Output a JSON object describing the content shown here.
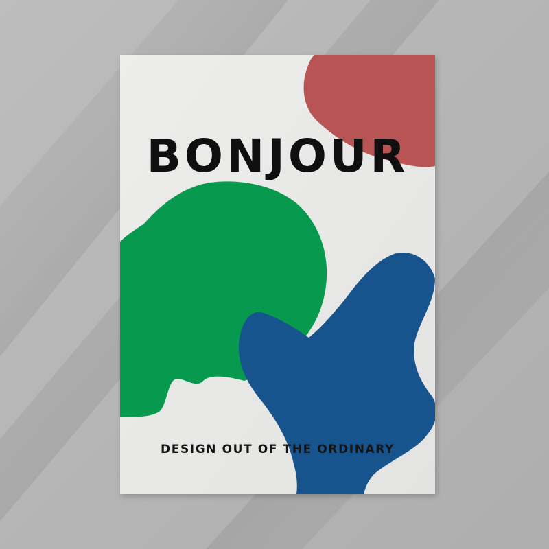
{
  "poster": {
    "title": "BONJOUR",
    "tagline": "DESIGN OUT OF THE ORDINARY"
  },
  "colors": {
    "wall": "#b9b9b9",
    "paper": "#e9e9e7",
    "red_shape": "#b85453",
    "green_shape": "#079a4f",
    "blue_shape": "#17548e",
    "text": "#111111"
  }
}
